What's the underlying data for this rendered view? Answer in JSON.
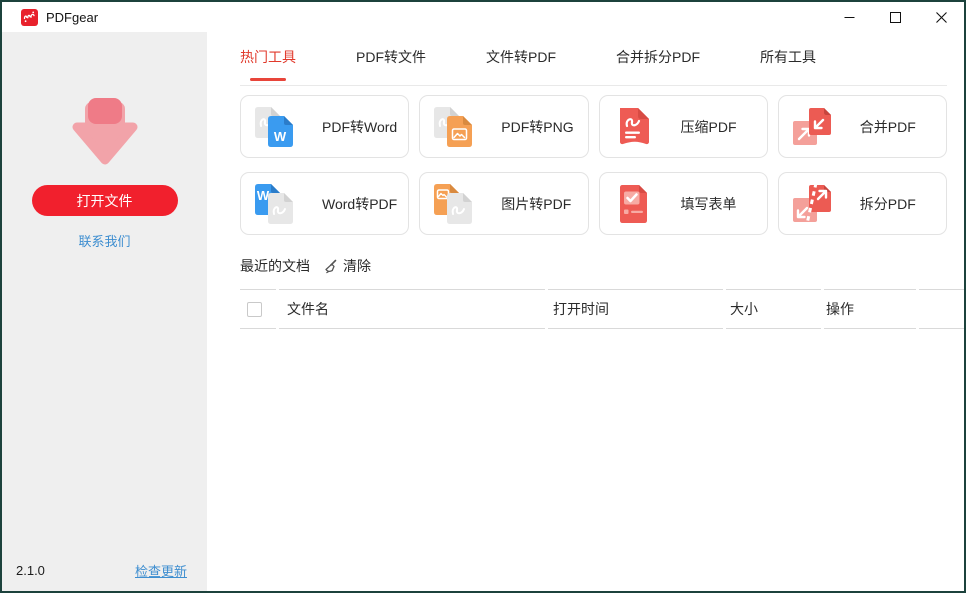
{
  "app": {
    "title": "PDFgear",
    "version": "2.1.0"
  },
  "window_controls": {
    "minimize_icon": "minimize",
    "maximize_icon": "maximize",
    "close_icon": "close"
  },
  "sidebar": {
    "open_file_button": "打开文件",
    "contact_link": "联系我们",
    "check_update_link": "检查更新"
  },
  "tabs": [
    {
      "label": "热门工具",
      "active": true
    },
    {
      "label": "PDF转文件",
      "active": false
    },
    {
      "label": "文件转PDF",
      "active": false
    },
    {
      "label": "合并拆分PDF",
      "active": false
    },
    {
      "label": "所有工具",
      "active": false
    }
  ],
  "tools": [
    {
      "label": "PDF转Word",
      "icon": "pdf-to-word-icon"
    },
    {
      "label": "PDF转PNG",
      "icon": "pdf-to-png-icon"
    },
    {
      "label": "压缩PDF",
      "icon": "compress-pdf-icon"
    },
    {
      "label": "合并PDF",
      "icon": "merge-pdf-icon"
    },
    {
      "label": "Word转PDF",
      "icon": "word-to-pdf-icon"
    },
    {
      "label": "图片转PDF",
      "icon": "image-to-pdf-icon"
    },
    {
      "label": "填写表单",
      "icon": "fill-forms-icon"
    },
    {
      "label": "拆分PDF",
      "icon": "split-pdf-icon"
    }
  ],
  "icons": {
    "word_letter": "W",
    "clear_icon": "broom",
    "sidebar_graphic": "download-arrow"
  },
  "recent": {
    "title": "最近的文档",
    "clear_label": "清除"
  },
  "table": {
    "columns": [
      "文件名",
      "打开时间",
      "大小",
      "操作"
    ],
    "rows": []
  },
  "colors": {
    "accent_red": "#f1202d",
    "tab_active_red": "#e13a2c",
    "link_blue": "#3e8ed0",
    "sidebar_bg": "#efefef",
    "salmon": "#ee5b54",
    "salmon_light": "#f4a09a",
    "doc_blue": "#3a9bf0",
    "doc_orange": "#f5a054",
    "doc_gray": "#e7e7e7",
    "window_border": "#1c423c"
  }
}
